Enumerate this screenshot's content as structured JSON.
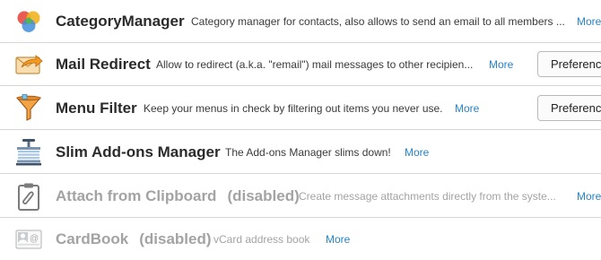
{
  "addons": [
    {
      "name": "CategoryManager",
      "disabled_label": "",
      "description": "Category manager for contacts, also allows to send an email to all members ...",
      "more_label": "More",
      "preferences_label": "",
      "icon": "category-manager-icon"
    },
    {
      "name": "Mail Redirect",
      "disabled_label": "",
      "description": "Allow to redirect (a.k.a. \"remail\") mail messages to other recipien...",
      "more_label": "More",
      "preferences_label": "Preferences",
      "icon": "envelope-arrow-icon"
    },
    {
      "name": "Menu Filter",
      "disabled_label": "",
      "description": "Keep your menus in check by filtering out items you never use.",
      "more_label": "More",
      "preferences_label": "Preferences",
      "icon": "funnel-icon"
    },
    {
      "name": "Slim Add-ons Manager",
      "disabled_label": "",
      "description": "The Add-ons Manager slims down!",
      "more_label": "More",
      "preferences_label": "",
      "icon": "vise-icon"
    },
    {
      "name": "Attach from Clipboard",
      "disabled_label": "(disabled)",
      "description": "Create message attachments directly from the syste...",
      "more_label": "More",
      "preferences_label": "",
      "icon": "clipboard-paperclip-icon"
    },
    {
      "name": "CardBook",
      "disabled_label": "(disabled)",
      "description": "vCard address book",
      "more_label": "More",
      "preferences_label": "",
      "icon": "contact-card-icon"
    }
  ]
}
